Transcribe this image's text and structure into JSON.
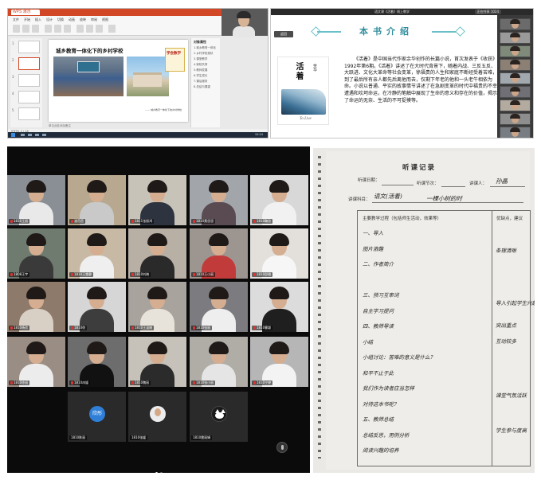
{
  "ppt": {
    "app_tab": "WPS 演示",
    "menu_items": [
      "文件",
      "开始",
      "插入",
      "设计",
      "切换",
      "动画",
      "放映",
      "审阅",
      "视图"
    ],
    "slide_title": "城乡教育一体化下的乡村学校",
    "book_label": "学会数学",
    "slide_credit": "—— 城乡教育一体化下的乡村学校",
    "pane_title": "对象属性",
    "pane_items": [
      "1.城乡教育一体化",
      "2.乡村学校现状",
      "3.课堂教学",
      "4.家校共育",
      "5.教师发展",
      "6.学生成长",
      "7.课后服务",
      "8.总结与展望"
    ],
    "status_text": "幻灯片 2 / 18",
    "notes_text": "单击此处添加备注",
    "tray_time": "10:24",
    "thumb_numbers": [
      "1",
      "2",
      "3",
      "4",
      "5"
    ]
  },
  "book": {
    "window_title": "语文课《活着》线上教学",
    "window_badge": "正在共享 1024",
    "back_button": "返回",
    "heading": "本书介绍",
    "cover_title": "活着",
    "cover_author": "余华",
    "cover_subtitle": "To Live",
    "description": "《活着》是中国当代作家余华创作的长篇小说，首次发表于《收获》1992年第6期。《活着》讲述了在大时代背景下，随着内战、三反五反、大跃进、文化大革命等社会变革，徐福贵的人生和家庭不断经受着苦难，到了最后所有亲人都先后离他而去，仅剩下年老的他和一头老牛相依为命。小说以普通、平实的故事情节讲述了在急剧变革的时代中福贵的不幸遭遇和坎坷命运，在冷静的笔触中展现了生命的意义和存在的价值，揭示了命运的无奈、生活的不可捉摸等。"
  },
  "meeting": {
    "participants": [
      {
        "name": "1810王丽",
        "bg": "#8a8f96",
        "shirt": "#e9e9e9"
      },
      {
        "name": "潘蓓蓓",
        "bg": "#b7a88f",
        "shirt": "#c9c9c9"
      },
      {
        "name": "1811张振鸿",
        "bg": "#c8c3b8",
        "shirt": "#2e3340"
      },
      {
        "name": "1810黄思思",
        "bg": "#a2a6aa",
        "shirt": "#5a4a52"
      },
      {
        "name": "1810鞠欣",
        "bg": "#d8d8d8",
        "shirt": "#f1f1f1"
      },
      {
        "name": "1808王宇",
        "bg": "#6f7b6f",
        "shirt": "#3a3a3a"
      },
      {
        "name": "1810王雯静",
        "bg": "#c7b9a3",
        "shirt": "#efefef"
      },
      {
        "name": "1810刘晓",
        "bg": "#b8b0a5",
        "shirt": "#2a2a2a"
      },
      {
        "name": "1810王小丽",
        "bg": "#9d9690",
        "shirt": "#c23b3b"
      },
      {
        "name": "1810邱雅",
        "bg": "#e3e0dc",
        "shirt": "#f6f6f6"
      },
      {
        "name": "1810杨欣",
        "bg": "#8e7a6a",
        "shirt": "#d8cfc5"
      },
      {
        "name": "1810徐",
        "bg": "#d6d6d6",
        "shirt": "#3d3d3d"
      },
      {
        "name": "1810王温婉",
        "bg": "#a8a39c",
        "shirt": "#e7e2da"
      },
      {
        "name": "1810张丽",
        "bg": "#7c7c80",
        "shirt": "#eeeeee"
      },
      {
        "name": "1810曹颖",
        "bg": "#dcdcdc",
        "shirt": "#1f1f1f"
      },
      {
        "name": "1810徐丽",
        "bg": "#9a8d83",
        "shirt": "#ececec"
      },
      {
        "name": "1810冉媛",
        "bg": "#6d6d6d",
        "shirt": "#111111"
      },
      {
        "name": "1810魏丽",
        "bg": "#c7c2b9",
        "shirt": "#2b2b2b"
      },
      {
        "name": "1810张小丽",
        "bg": "#b0aca6",
        "shirt": "#e5e5e5"
      },
      {
        "name": "1810宁婷",
        "bg": "#b6b6b6",
        "shirt": "#f3f3f3"
      }
    ],
    "audio_participants": [
      {
        "name": "1810陈丽",
        "avatar": "text",
        "avatar_text": "欣彤"
      },
      {
        "name": "1810张媛",
        "avatar": "photo",
        "avatar_text": ""
      },
      {
        "name": "1810雷丽娟",
        "avatar": "cat",
        "avatar_text": ""
      }
    ]
  },
  "form": {
    "title": "听课记录",
    "date_label": "听课日期：",
    "session_label": "听课节次：",
    "lecturer_label": "讲课人：",
    "lecturer": "孙晶",
    "subject_label": "讲课科目：",
    "subject": "语文(活着)",
    "class_label": "一棵小树的时",
    "process_header": "主要教学过程（包括师生活动，效果等）",
    "merit_header": "优缺点，建议",
    "process_lines": [
      "一、导入",
      "  图片激趣",
      "二、作者简介",
      "",
      "三、预习互审词",
      "  自主学习提问",
      "四、教师导读",
      "  小结",
      "小组讨论：苦难的意义是什么？",
      "和平不止于此",
      "我们作为读者应当怎样",
      "对待这本书呢？",
      "五、教师总结",
      "  总结反思，用例分析",
      "  阅读兴趣的培养"
    ],
    "merit_lines": [
      "条理清晰",
      "导入引起学生兴趣",
      "突出重点",
      "互动较多",
      "课堂气氛活跃",
      "学生参与度高"
    ]
  }
}
